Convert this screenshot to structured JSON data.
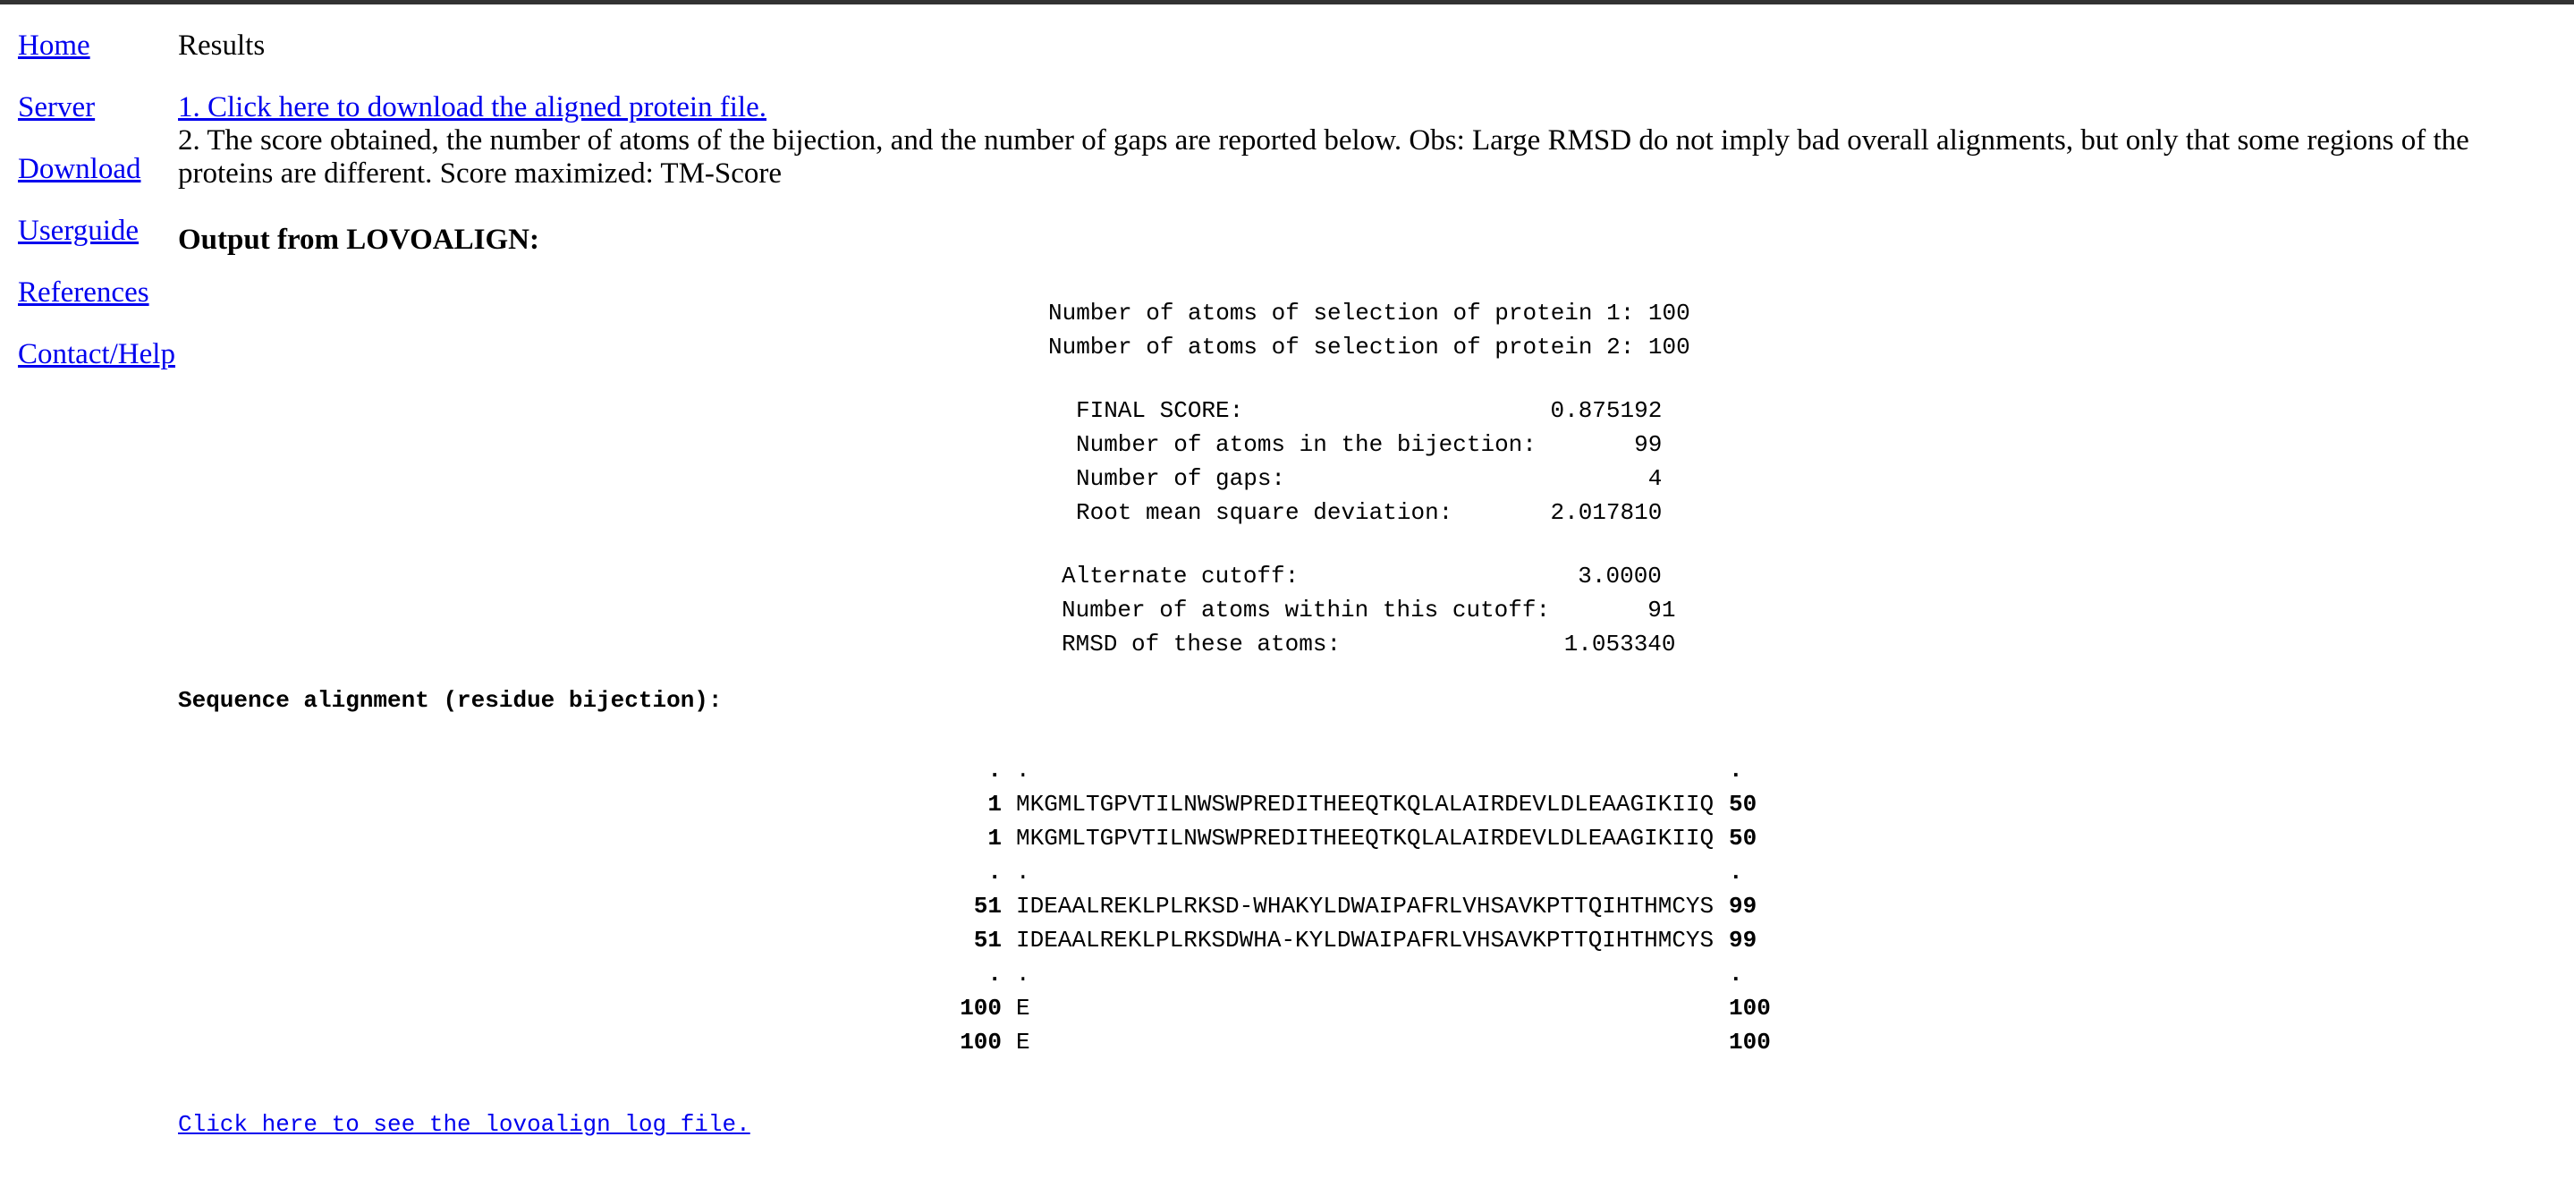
{
  "nav": {
    "items": [
      "Home",
      "Server",
      "Download",
      "Userguide",
      "References",
      "Contact/Help"
    ]
  },
  "main": {
    "title": "Results",
    "download_link": "1. Click here to download the aligned protein file.",
    "description": "2. The score obtained, the number of atoms of the bijection, and the number of gaps are reported below. Obs: Large RMSD do not imply bad overall alignments, but only that some regions of the proteins are different. Score maximized: TM-Score",
    "output_heading": "Output from LOVOALIGN:"
  },
  "selection": {
    "protein1_line": "Number of atoms of selection of protein 1: 100",
    "protein2_line": "Number of atoms of selection of protein 2: 100"
  },
  "score": {
    "final_score_line": "FINAL SCORE:                      0.875192",
    "bijection_line": "Number of atoms in the bijection:       99",
    "gaps_line": "Number of gaps:                          4",
    "rmsd_line": "Root mean square deviation:       2.017810"
  },
  "cutoff": {
    "alternate_line": "Alternate cutoff:                    3.0000",
    "within_line": "Number of atoms within this cutoff:       91",
    "rmsd_line": "RMSD of these atoms:                1.053340"
  },
  "alignment": {
    "heading": "Sequence alignment (residue bijection):",
    "rows": [
      {
        "start": ".",
        "seq": ".",
        "end": "."
      },
      {
        "start": "1",
        "seq": "MKGMLTGPVTILNWSWPREDITHEEQTKQLALAIRDEVLDLEAAGIKIIQ",
        "end": "50"
      },
      {
        "start": "1",
        "seq": "MKGMLTGPVTILNWSWPREDITHEEQTKQLALAIRDEVLDLEAAGIKIIQ",
        "end": "50"
      },
      {
        "start": ".",
        "seq": ".",
        "end": "."
      },
      {
        "start": "51",
        "seq": "IDEAALREKLPLRKSD-WHAKYLDWAIPAFRLVHSAVKPTTQIHTHMCYS",
        "end": "99"
      },
      {
        "start": "51",
        "seq": "IDEAALREKLPLRKSDWHA-KYLDWAIPAFRLVHSAVKPTTQIHTHMCYS",
        "end": "99"
      },
      {
        "start": ".",
        "seq": ".",
        "end": "."
      },
      {
        "start": "100",
        "seq": "E",
        "end": "100"
      },
      {
        "start": "100",
        "seq": "E",
        "end": "100"
      }
    ]
  },
  "log_link": "Click here to see the lovoalign log file."
}
